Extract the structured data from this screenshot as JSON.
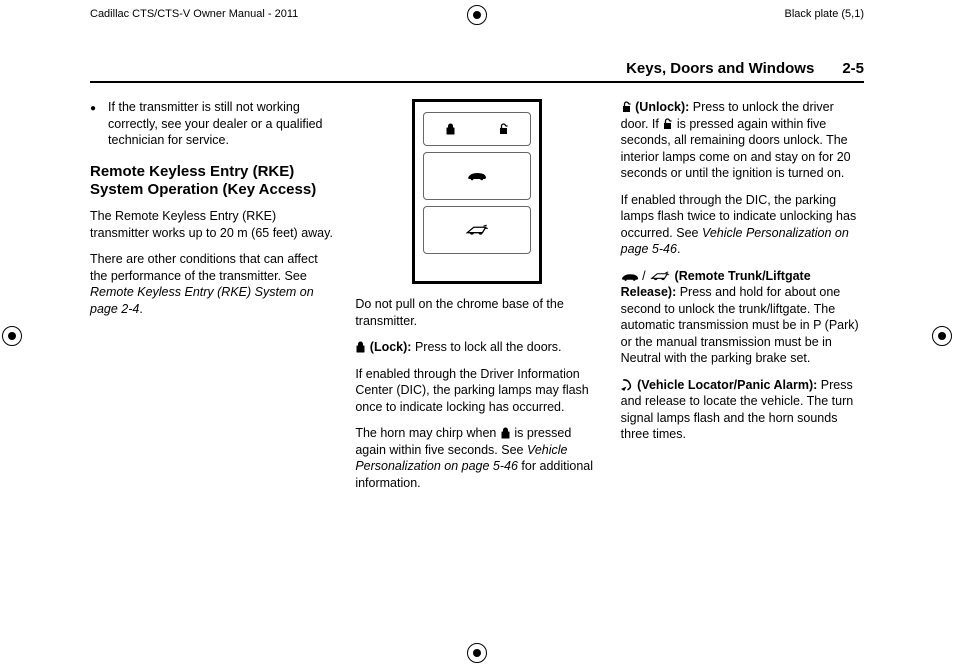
{
  "top": {
    "manual_title": "Cadillac CTS/CTS-V Owner Manual - 2011",
    "plate": "Black plate (5,1)"
  },
  "header": {
    "section": "Keys, Doors and Windows",
    "page": "2-5"
  },
  "col1": {
    "bullet": "If the transmitter is still not working correctly, see your dealer or a qualified technician for service.",
    "h2": "Remote Keyless Entry (RKE) System Operation (Key Access)",
    "p1": "The Remote Keyless Entry (RKE) transmitter works up to 20 m (65 feet) away.",
    "p2a": "There are other conditions that can affect the performance of the transmitter. See ",
    "p2b": "Remote Keyless Entry (RKE) System on page 2‑4",
    "p2c": "."
  },
  "col2": {
    "p1": "Do not pull on the chrome base of the transmitter.",
    "lock_label": " (Lock): ",
    "lock_text": "Press to lock all the doors.",
    "p3": "If enabled through the Driver Information Center (DIC), the parking lamps may flash once to indicate locking has occurred.",
    "p4a": "The horn may chirp when ",
    "p4b": " is pressed again within five seconds. See ",
    "p4c": "Vehicle Personalization on page 5‑46",
    "p4d": " for additional information."
  },
  "col3": {
    "unlock_label": " (Unlock): ",
    "unlock_a": "Press to unlock the driver door. If ",
    "unlock_b": " is pressed again within five seconds, all remaining doors unlock. The interior lamps come on and stay on for 20 seconds or until the ignition is turned on.",
    "p2a": "If enabled through the DIC, the parking lamps flash twice to indicate unlocking has occurred. See ",
    "p2b": "Vehicle Personalization on page 5‑46",
    "p2c": ".",
    "trunk_sep": " / ",
    "trunk_label": " (Remote Trunk/Liftgate Release): ",
    "trunk_text": "Press and hold for about one second to unlock the trunk/liftgate. The automatic transmission must be in P (Park) or the manual transmission must be in Neutral with the parking brake set.",
    "panic_label": " (Vehicle Locator/Panic Alarm): ",
    "panic_text": "Press and release to locate the vehicle. The turn signal lamps flash and the horn sounds three times."
  }
}
